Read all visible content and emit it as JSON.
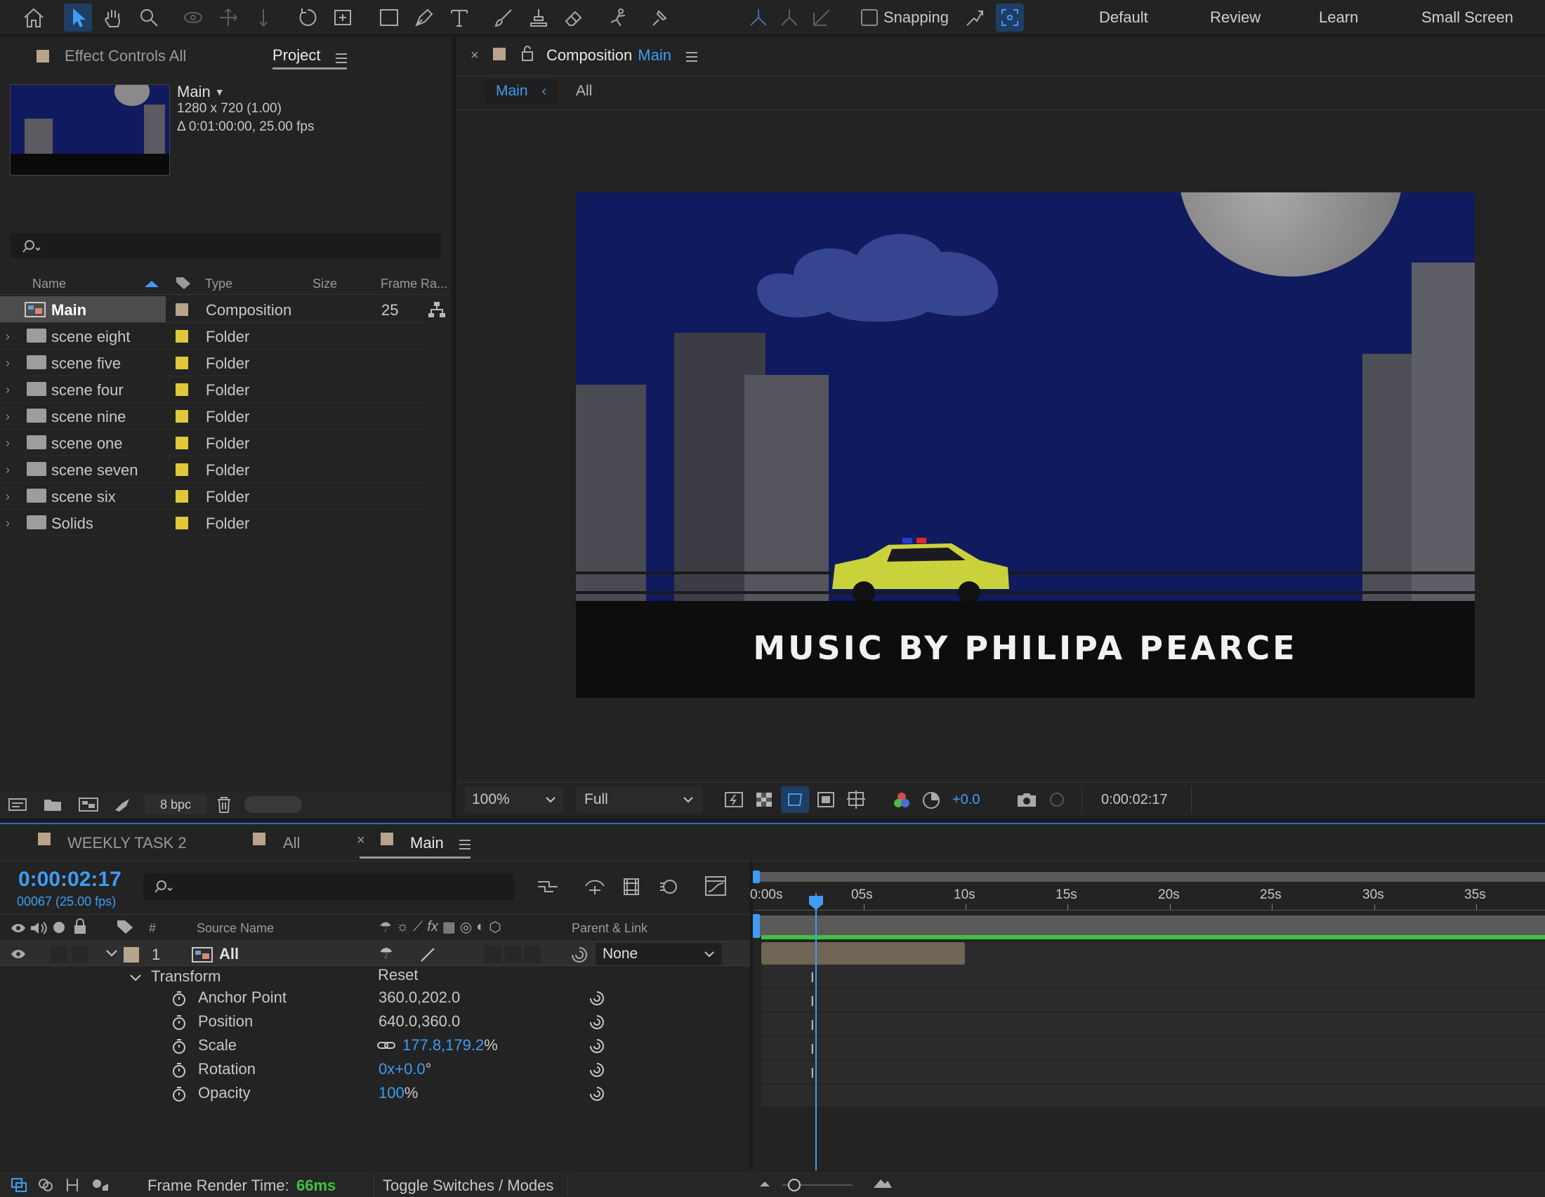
{
  "toolbar": {
    "snapping_label": "Snapping",
    "workspaces": [
      "Default",
      "Review",
      "Learn",
      "Small Screen"
    ]
  },
  "project": {
    "tab_effect_controls": "Effect Controls All",
    "tab_project": "Project",
    "comp_name": "Main",
    "comp_dimensions": "1280 x 720 (1.00)",
    "comp_duration": "Δ 0:01:00:00, 25.00 fps",
    "columns": {
      "name": "Name",
      "type": "Type",
      "size": "Size",
      "frame_rate": "Frame Ra..."
    },
    "items": [
      {
        "name": "Main",
        "type": "Composition",
        "frame_rate": "25"
      },
      {
        "name": "scene eight",
        "type": "Folder"
      },
      {
        "name": "scene five",
        "type": "Folder"
      },
      {
        "name": "scene four",
        "type": "Folder"
      },
      {
        "name": "scene nine",
        "type": "Folder"
      },
      {
        "name": "scene one",
        "type": "Folder"
      },
      {
        "name": "scene seven",
        "type": "Folder"
      },
      {
        "name": "scene six",
        "type": "Folder"
      },
      {
        "name": "Solids",
        "type": "Folder"
      }
    ],
    "bpc": "8 bpc"
  },
  "composition": {
    "tab_prefix": "Composition",
    "tab_name": "Main",
    "breadcrumb_main": "Main",
    "breadcrumb_all": "All",
    "viewer_caption": "MUSIC BY PHILIPA PEARCE",
    "zoom": "100%",
    "resolution": "Full",
    "exposure": "+0.0",
    "timecode": "0:00:02:17"
  },
  "timeline": {
    "tabs": [
      "WEEKLY TASK 2",
      "All",
      "Main"
    ],
    "current_time": "0:00:02:17",
    "frame_info": "00067 (25.00 fps)",
    "col_number": "#",
    "col_source": "Source Name",
    "col_parent": "Parent & Link",
    "layer": {
      "index": "1",
      "name": "All",
      "parent": "None"
    },
    "transform_label": "Transform",
    "reset_label": "Reset",
    "properties": [
      {
        "name": "Anchor Point",
        "value": "360.0,202.0"
      },
      {
        "name": "Position",
        "value": "640.0,360.0"
      },
      {
        "name": "Scale",
        "value": "177.8,179.2",
        "unit": "%"
      },
      {
        "name": "Rotation",
        "value": "0x+0.0",
        "unit": "°"
      },
      {
        "name": "Opacity",
        "value": "100",
        "unit": "%"
      }
    ],
    "ruler_labels": [
      "0:00s",
      "05s",
      "10s",
      "15s",
      "20s",
      "25s",
      "30s",
      "35s"
    ],
    "render_time_label": "Frame Render Time:",
    "render_time_value": "66ms",
    "toggle_label": "Toggle Switches / Modes"
  },
  "colors": {
    "accent": "#3e9cf5",
    "label_tan": "#b8a48a",
    "label_yellow": "#e0c83a",
    "work_area": "#3ec43e"
  }
}
